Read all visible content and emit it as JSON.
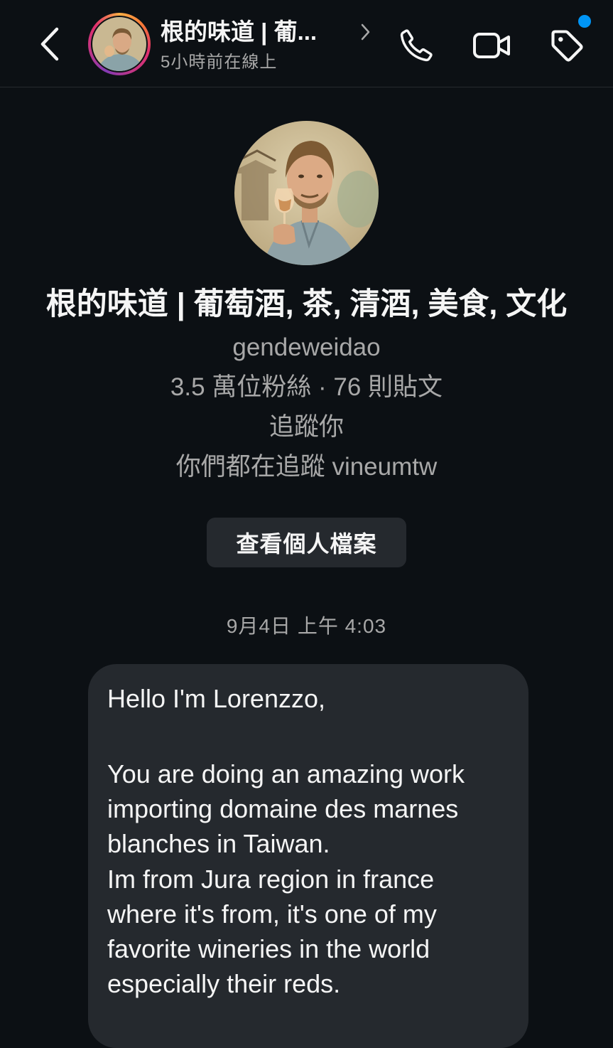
{
  "header": {
    "title": "根的味道 | 葡...",
    "status": "5小時前在線上",
    "back_icon": "chevron-left-icon",
    "call_icon": "phone-icon",
    "video_icon": "video-camera-icon",
    "tag_icon": "tag-icon"
  },
  "profile": {
    "name": "根的味道 | 葡萄酒, 茶, 清酒, 美食, 文化",
    "username": "gendeweidao",
    "stats": "3.5 萬位粉絲 · 76 則貼文",
    "follows_you": "追蹤你",
    "mutual": "你們都在追蹤 vineumtw",
    "view_profile_label": "查看個人檔案"
  },
  "conversation": {
    "timestamp": "9月4日 上午 4:03",
    "messages": [
      {
        "greeting": "Hello I'm Lorenzzo,",
        "paragraph_1": "You are doing an amazing work importing domaine des marnes blanches in Taiwan.",
        "paragraph_2": "Im from Jura region in france where it's from, it's one of my favorite wineries in the world especially their reds."
      }
    ]
  },
  "colors": {
    "background": "#0c1014",
    "bubble": "#25292e",
    "secondary_text": "#a8a8a8",
    "notification_dot": "#0095f6"
  }
}
